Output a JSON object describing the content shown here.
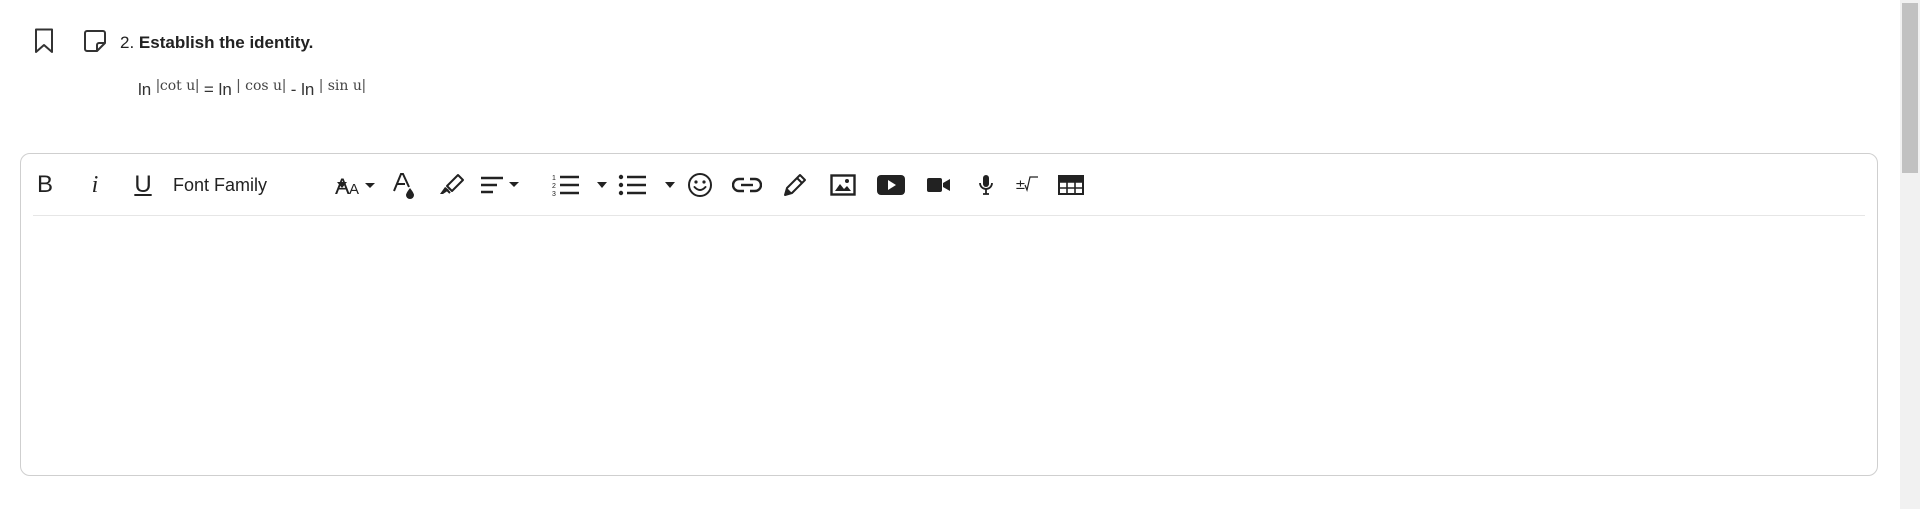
{
  "question": {
    "number": "2.",
    "title": "Establish the identity.",
    "identity": {
      "ln1": "ln",
      "arg1": "cot u",
      "eq": "= ln",
      "arg2": "cos u",
      "minus": "- ln",
      "arg3": "sin u",
      "bar": "|"
    }
  },
  "toolbar": {
    "bold": "B",
    "italic": "i",
    "underline": "U",
    "font_family": "Font Family"
  },
  "icons": [
    "bookmark-icon",
    "note-icon",
    "bold-icon",
    "italic-icon",
    "underline-icon",
    "font-size-icon",
    "text-color-icon",
    "highlight-icon",
    "align-icon",
    "ordered-list-icon",
    "unordered-list-icon",
    "emoji-icon",
    "link-icon",
    "draw-icon",
    "image-icon",
    "video-icon",
    "camera-icon",
    "microphone-icon",
    "math-icon",
    "table-icon"
  ],
  "colors": {
    "text": "#222222",
    "border": "#cfcfcf",
    "scroll_thumb": "#c1c1c1"
  }
}
